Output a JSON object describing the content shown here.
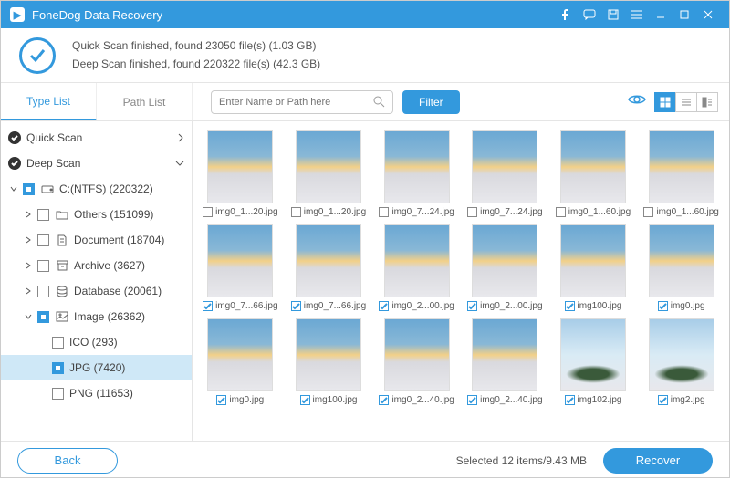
{
  "title": "FoneDog Data Recovery",
  "status": {
    "line1": "Quick Scan finished, found 23050 file(s) (1.03 GB)",
    "line2": "Deep Scan finished, found 220322 file(s) (42.3 GB)"
  },
  "tabs": {
    "type_list": "Type List",
    "path_list": "Path List"
  },
  "search": {
    "placeholder": "Enter Name or Path here"
  },
  "filter_label": "Filter",
  "sidebar": {
    "quick_scan": "Quick Scan",
    "deep_scan": "Deep Scan",
    "drive": "C:(NTFS) (220322)",
    "others": "Others (151099)",
    "document": "Document (18704)",
    "archive": "Archive (3627)",
    "database": "Database (20061)",
    "image": "Image (26362)",
    "ico": "ICO (293)",
    "jpg": "JPG (7420)",
    "png": "PNG (11653)"
  },
  "files": [
    {
      "name": "img0_1...20.jpg",
      "checked": false,
      "alt": false
    },
    {
      "name": "img0_1...20.jpg",
      "checked": false,
      "alt": false
    },
    {
      "name": "img0_7...24.jpg",
      "checked": false,
      "alt": false
    },
    {
      "name": "img0_7...24.jpg",
      "checked": false,
      "alt": false
    },
    {
      "name": "img0_1...60.jpg",
      "checked": false,
      "alt": false
    },
    {
      "name": "img0_1...60.jpg",
      "checked": false,
      "alt": false
    },
    {
      "name": "img0_7...66.jpg",
      "checked": true,
      "alt": false
    },
    {
      "name": "img0_7...66.jpg",
      "checked": true,
      "alt": false
    },
    {
      "name": "img0_2...00.jpg",
      "checked": true,
      "alt": false
    },
    {
      "name": "img0_2...00.jpg",
      "checked": true,
      "alt": false
    },
    {
      "name": "img100.jpg",
      "checked": true,
      "alt": false
    },
    {
      "name": "img0.jpg",
      "checked": true,
      "alt": false
    },
    {
      "name": "img0.jpg",
      "checked": true,
      "alt": false
    },
    {
      "name": "img100.jpg",
      "checked": true,
      "alt": false
    },
    {
      "name": "img0_2...40.jpg",
      "checked": true,
      "alt": false
    },
    {
      "name": "img0_2...40.jpg",
      "checked": true,
      "alt": false
    },
    {
      "name": "img102.jpg",
      "checked": true,
      "alt": true
    },
    {
      "name": "img2.jpg",
      "checked": true,
      "alt": true
    }
  ],
  "footer": {
    "back": "Back",
    "selected": "Selected 12 items/9.43 MB",
    "recover": "Recover"
  }
}
